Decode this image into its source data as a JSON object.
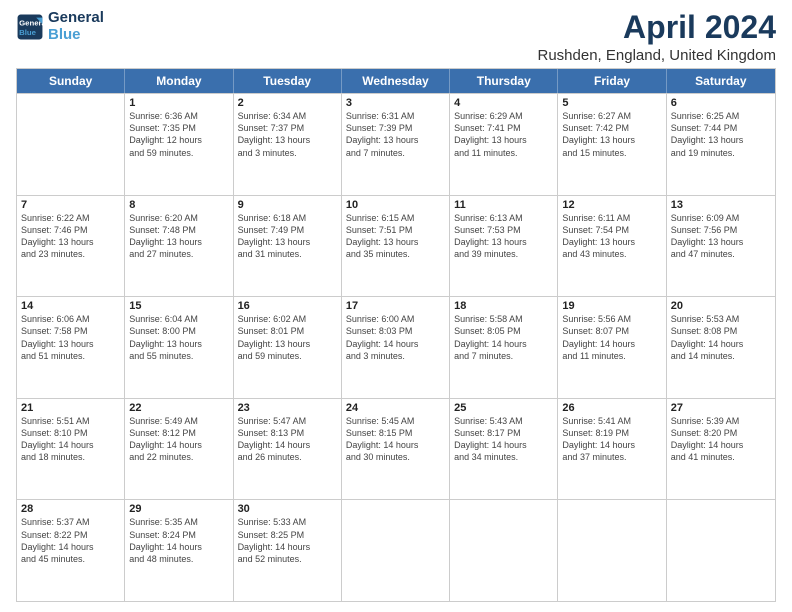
{
  "logo": {
    "line1": "General",
    "line2": "Blue"
  },
  "title": "April 2024",
  "location": "Rushden, England, United Kingdom",
  "weekdays": [
    "Sunday",
    "Monday",
    "Tuesday",
    "Wednesday",
    "Thursday",
    "Friday",
    "Saturday"
  ],
  "weeks": [
    [
      {
        "day": "",
        "sunrise": "",
        "sunset": "",
        "daylight": ""
      },
      {
        "day": "1",
        "sunrise": "Sunrise: 6:36 AM",
        "sunset": "Sunset: 7:35 PM",
        "daylight": "Daylight: 12 hours",
        "daylight2": "and 59 minutes."
      },
      {
        "day": "2",
        "sunrise": "Sunrise: 6:34 AM",
        "sunset": "Sunset: 7:37 PM",
        "daylight": "Daylight: 13 hours",
        "daylight2": "and 3 minutes."
      },
      {
        "day": "3",
        "sunrise": "Sunrise: 6:31 AM",
        "sunset": "Sunset: 7:39 PM",
        "daylight": "Daylight: 13 hours",
        "daylight2": "and 7 minutes."
      },
      {
        "day": "4",
        "sunrise": "Sunrise: 6:29 AM",
        "sunset": "Sunset: 7:41 PM",
        "daylight": "Daylight: 13 hours",
        "daylight2": "and 11 minutes."
      },
      {
        "day": "5",
        "sunrise": "Sunrise: 6:27 AM",
        "sunset": "Sunset: 7:42 PM",
        "daylight": "Daylight: 13 hours",
        "daylight2": "and 15 minutes."
      },
      {
        "day": "6",
        "sunrise": "Sunrise: 6:25 AM",
        "sunset": "Sunset: 7:44 PM",
        "daylight": "Daylight: 13 hours",
        "daylight2": "and 19 minutes."
      }
    ],
    [
      {
        "day": "7",
        "sunrise": "Sunrise: 6:22 AM",
        "sunset": "Sunset: 7:46 PM",
        "daylight": "Daylight: 13 hours",
        "daylight2": "and 23 minutes."
      },
      {
        "day": "8",
        "sunrise": "Sunrise: 6:20 AM",
        "sunset": "Sunset: 7:48 PM",
        "daylight": "Daylight: 13 hours",
        "daylight2": "and 27 minutes."
      },
      {
        "day": "9",
        "sunrise": "Sunrise: 6:18 AM",
        "sunset": "Sunset: 7:49 PM",
        "daylight": "Daylight: 13 hours",
        "daylight2": "and 31 minutes."
      },
      {
        "day": "10",
        "sunrise": "Sunrise: 6:15 AM",
        "sunset": "Sunset: 7:51 PM",
        "daylight": "Daylight: 13 hours",
        "daylight2": "and 35 minutes."
      },
      {
        "day": "11",
        "sunrise": "Sunrise: 6:13 AM",
        "sunset": "Sunset: 7:53 PM",
        "daylight": "Daylight: 13 hours",
        "daylight2": "and 39 minutes."
      },
      {
        "day": "12",
        "sunrise": "Sunrise: 6:11 AM",
        "sunset": "Sunset: 7:54 PM",
        "daylight": "Daylight: 13 hours",
        "daylight2": "and 43 minutes."
      },
      {
        "day": "13",
        "sunrise": "Sunrise: 6:09 AM",
        "sunset": "Sunset: 7:56 PM",
        "daylight": "Daylight: 13 hours",
        "daylight2": "and 47 minutes."
      }
    ],
    [
      {
        "day": "14",
        "sunrise": "Sunrise: 6:06 AM",
        "sunset": "Sunset: 7:58 PM",
        "daylight": "Daylight: 13 hours",
        "daylight2": "and 51 minutes."
      },
      {
        "day": "15",
        "sunrise": "Sunrise: 6:04 AM",
        "sunset": "Sunset: 8:00 PM",
        "daylight": "Daylight: 13 hours",
        "daylight2": "and 55 minutes."
      },
      {
        "day": "16",
        "sunrise": "Sunrise: 6:02 AM",
        "sunset": "Sunset: 8:01 PM",
        "daylight": "Daylight: 13 hours",
        "daylight2": "and 59 minutes."
      },
      {
        "day": "17",
        "sunrise": "Sunrise: 6:00 AM",
        "sunset": "Sunset: 8:03 PM",
        "daylight": "Daylight: 14 hours",
        "daylight2": "and 3 minutes."
      },
      {
        "day": "18",
        "sunrise": "Sunrise: 5:58 AM",
        "sunset": "Sunset: 8:05 PM",
        "daylight": "Daylight: 14 hours",
        "daylight2": "and 7 minutes."
      },
      {
        "day": "19",
        "sunrise": "Sunrise: 5:56 AM",
        "sunset": "Sunset: 8:07 PM",
        "daylight": "Daylight: 14 hours",
        "daylight2": "and 11 minutes."
      },
      {
        "day": "20",
        "sunrise": "Sunrise: 5:53 AM",
        "sunset": "Sunset: 8:08 PM",
        "daylight": "Daylight: 14 hours",
        "daylight2": "and 14 minutes."
      }
    ],
    [
      {
        "day": "21",
        "sunrise": "Sunrise: 5:51 AM",
        "sunset": "Sunset: 8:10 PM",
        "daylight": "Daylight: 14 hours",
        "daylight2": "and 18 minutes."
      },
      {
        "day": "22",
        "sunrise": "Sunrise: 5:49 AM",
        "sunset": "Sunset: 8:12 PM",
        "daylight": "Daylight: 14 hours",
        "daylight2": "and 22 minutes."
      },
      {
        "day": "23",
        "sunrise": "Sunrise: 5:47 AM",
        "sunset": "Sunset: 8:13 PM",
        "daylight": "Daylight: 14 hours",
        "daylight2": "and 26 minutes."
      },
      {
        "day": "24",
        "sunrise": "Sunrise: 5:45 AM",
        "sunset": "Sunset: 8:15 PM",
        "daylight": "Daylight: 14 hours",
        "daylight2": "and 30 minutes."
      },
      {
        "day": "25",
        "sunrise": "Sunrise: 5:43 AM",
        "sunset": "Sunset: 8:17 PM",
        "daylight": "Daylight: 14 hours",
        "daylight2": "and 34 minutes."
      },
      {
        "day": "26",
        "sunrise": "Sunrise: 5:41 AM",
        "sunset": "Sunset: 8:19 PM",
        "daylight": "Daylight: 14 hours",
        "daylight2": "and 37 minutes."
      },
      {
        "day": "27",
        "sunrise": "Sunrise: 5:39 AM",
        "sunset": "Sunset: 8:20 PM",
        "daylight": "Daylight: 14 hours",
        "daylight2": "and 41 minutes."
      }
    ],
    [
      {
        "day": "28",
        "sunrise": "Sunrise: 5:37 AM",
        "sunset": "Sunset: 8:22 PM",
        "daylight": "Daylight: 14 hours",
        "daylight2": "and 45 minutes."
      },
      {
        "day": "29",
        "sunrise": "Sunrise: 5:35 AM",
        "sunset": "Sunset: 8:24 PM",
        "daylight": "Daylight: 14 hours",
        "daylight2": "and 48 minutes."
      },
      {
        "day": "30",
        "sunrise": "Sunrise: 5:33 AM",
        "sunset": "Sunset: 8:25 PM",
        "daylight": "Daylight: 14 hours",
        "daylight2": "and 52 minutes."
      },
      {
        "day": "",
        "sunrise": "",
        "sunset": "",
        "daylight": ""
      },
      {
        "day": "",
        "sunrise": "",
        "sunset": "",
        "daylight": ""
      },
      {
        "day": "",
        "sunrise": "",
        "sunset": "",
        "daylight": ""
      },
      {
        "day": "",
        "sunrise": "",
        "sunset": "",
        "daylight": ""
      }
    ]
  ]
}
